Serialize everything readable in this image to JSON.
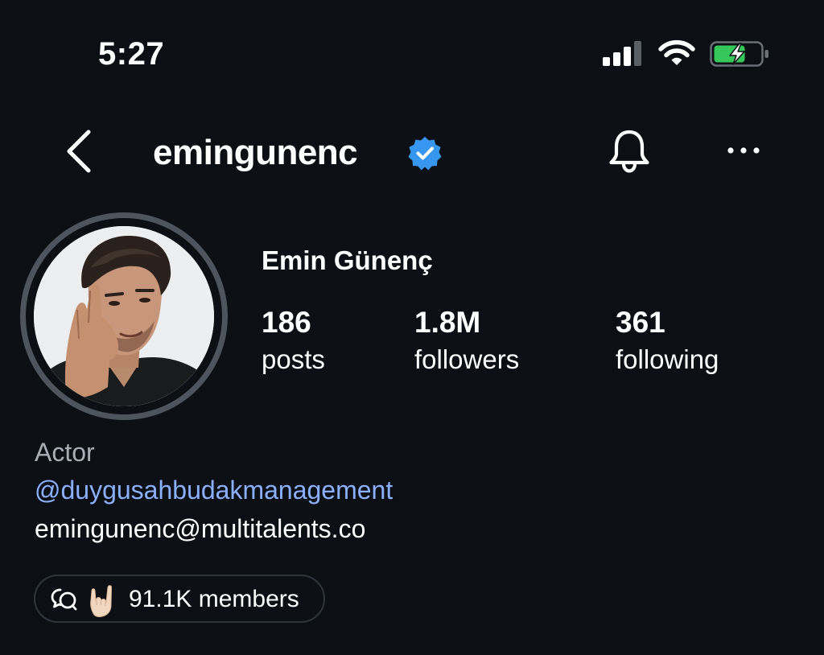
{
  "status_bar": {
    "time": "5:27",
    "signal_icon": "cellular-signal-icon",
    "wifi_icon": "wifi-icon",
    "battery_icon": "battery-charging-icon",
    "battery_color": "#35c759"
  },
  "header": {
    "back_icon": "chevron-left-icon",
    "username": "emingunenc",
    "verified_icon": "verified-badge-icon",
    "verified_color": "#3797f0",
    "bell_icon": "bell-icon",
    "more_icon": "more-horizontal-icon"
  },
  "profile": {
    "full_name": "Emin Günenç",
    "stats": [
      {
        "value": "186",
        "label": "posts"
      },
      {
        "value": "1.8M",
        "label": "followers"
      },
      {
        "value": "361",
        "label": "following"
      }
    ],
    "bio": {
      "category": "Actor",
      "mention": "@duygusahbudakmanagement",
      "email": "emingunenc@multitalents.co"
    },
    "channel": {
      "icon": "broadcast-channel-icon",
      "emoji": "🤟🏻",
      "members": "91.1K members"
    }
  },
  "colors": {
    "background": "#0c0f14",
    "link": "#8bb0ff",
    "muted_text": "#a9aeb6"
  }
}
